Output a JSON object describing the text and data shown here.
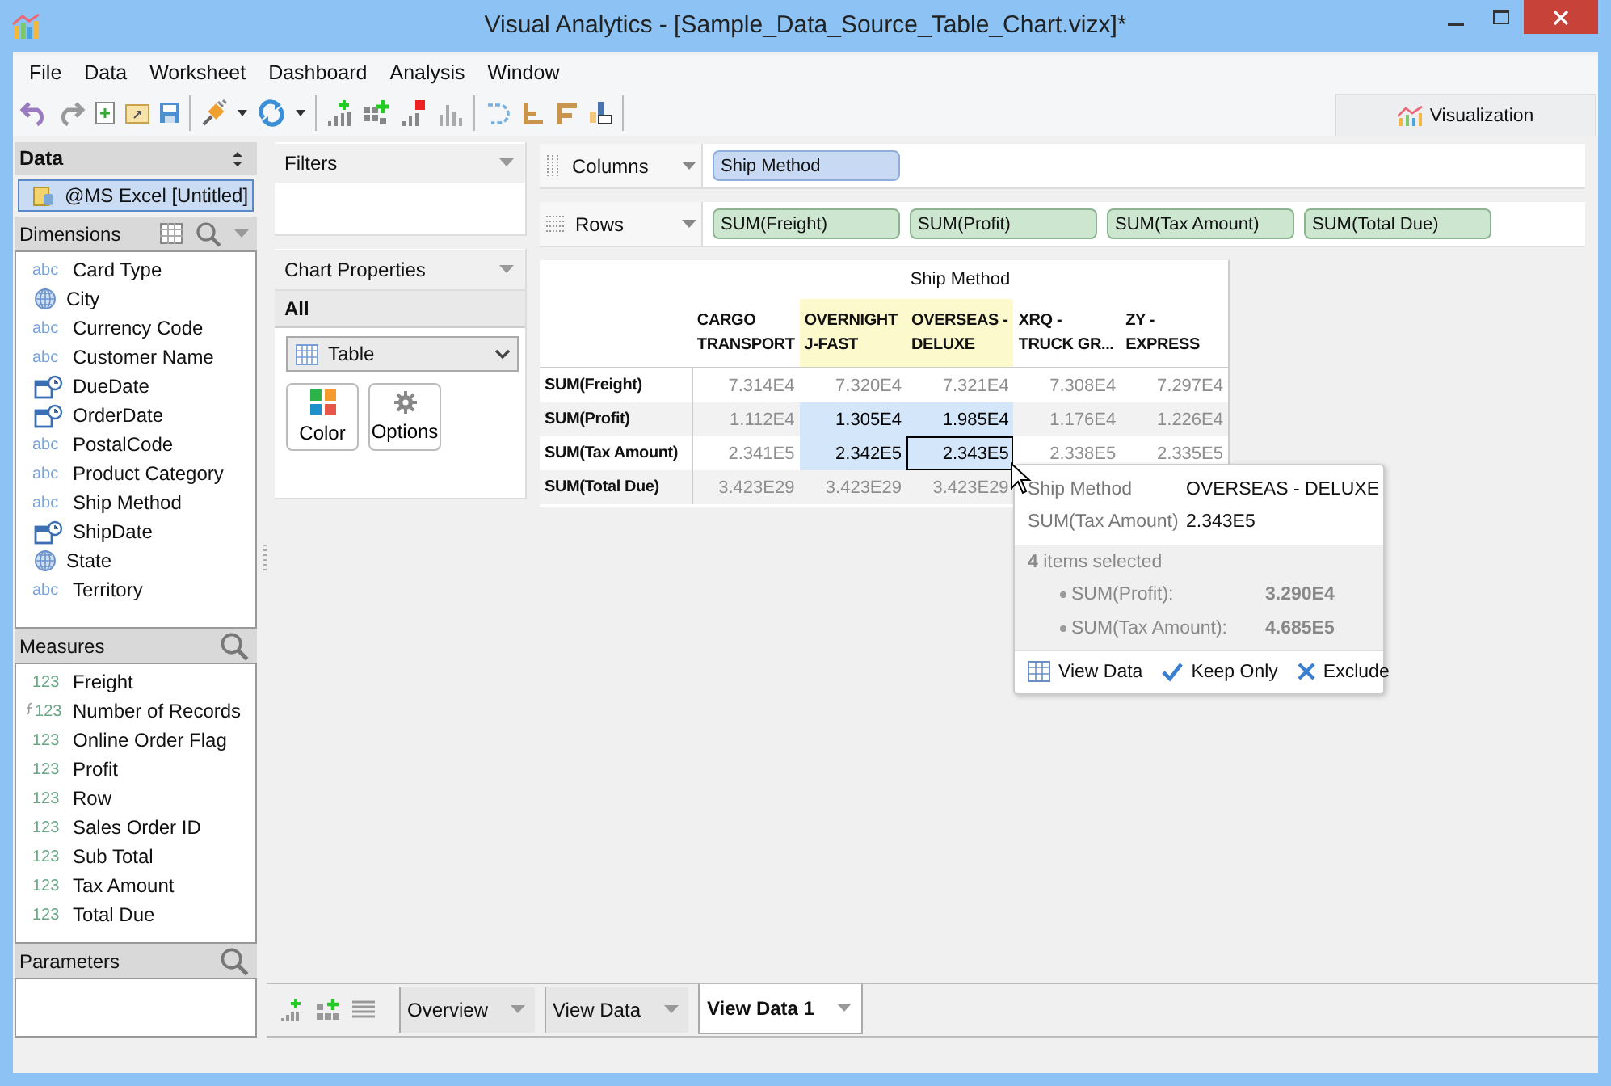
{
  "window": {
    "title": "Visual Analytics - [Sample_Data_Source_Table_Chart.vizx]*"
  },
  "menu": [
    "File",
    "Data",
    "Worksheet",
    "Dashboard",
    "Analysis",
    "Window"
  ],
  "view_tab": {
    "label": "Visualization"
  },
  "data_panel": {
    "title": "Data",
    "source": {
      "label": "@MS Excel [Untitled]",
      "selected": true
    }
  },
  "dimensions": {
    "title": "Dimensions",
    "items": [
      {
        "label": "Card Type",
        "kind": "text",
        "badge": "abc"
      },
      {
        "label": "City",
        "kind": "geo"
      },
      {
        "label": "Currency Code",
        "kind": "text",
        "badge": "abc"
      },
      {
        "label": "Customer Name",
        "kind": "text",
        "badge": "abc"
      },
      {
        "label": "DueDate",
        "kind": "date"
      },
      {
        "label": "OrderDate",
        "kind": "date"
      },
      {
        "label": "PostalCode",
        "kind": "text",
        "badge": "abc"
      },
      {
        "label": "Product Category",
        "kind": "text",
        "badge": "abc"
      },
      {
        "label": "Ship Method",
        "kind": "text",
        "badge": "abc"
      },
      {
        "label": "ShipDate",
        "kind": "date"
      },
      {
        "label": "State",
        "kind": "geo"
      },
      {
        "label": "Territory",
        "kind": "text",
        "badge": "abc"
      }
    ]
  },
  "measures": {
    "title": "Measures",
    "items": [
      {
        "label": "Freight",
        "kind": "number",
        "badge": "123"
      },
      {
        "label": "Number of Records",
        "kind": "calc",
        "badge": "123"
      },
      {
        "label": "Online Order Flag",
        "kind": "number",
        "badge": "123"
      },
      {
        "label": "Profit",
        "kind": "number",
        "badge": "123"
      },
      {
        "label": "Row",
        "kind": "number",
        "badge": "123"
      },
      {
        "label": "Sales Order ID",
        "kind": "number",
        "badge": "123"
      },
      {
        "label": "Sub Total",
        "kind": "number",
        "badge": "123"
      },
      {
        "label": "Tax Amount",
        "kind": "number",
        "badge": "123"
      },
      {
        "label": "Total Due",
        "kind": "number",
        "badge": "123"
      }
    ]
  },
  "parameters": {
    "title": "Parameters"
  },
  "filters": {
    "title": "Filters"
  },
  "chart_properties": {
    "title": "Chart Properties",
    "scope": "All",
    "chart_type": "Table",
    "buttons": [
      {
        "label": "Color",
        "kind": "color"
      },
      {
        "label": "Options",
        "kind": "options"
      }
    ]
  },
  "shelves": [
    {
      "label": "Columns",
      "kind": "columns",
      "pills": [
        {
          "label": "Ship Method",
          "kind": "dimension"
        }
      ]
    },
    {
      "label": "Rows",
      "kind": "rows",
      "pills": [
        {
          "label": "SUM(Freight)",
          "kind": "measure"
        },
        {
          "label": "SUM(Profit)",
          "kind": "measure"
        },
        {
          "label": "SUM(Tax Amount)",
          "kind": "measure"
        },
        {
          "label": "SUM(Total Due)",
          "kind": "measure"
        }
      ]
    }
  ],
  "table": {
    "header": "Ship Method",
    "columns": [
      {
        "label": "CARGO TRANSPORT",
        "highlighted": false
      },
      {
        "label": "OVERNIGHT J-FAST",
        "highlighted": true
      },
      {
        "label": "OVERSEAS - DELUXE",
        "highlighted": true
      },
      {
        "label": "XRQ - TRUCK GR...",
        "highlighted": false
      },
      {
        "label": "ZY - EXPRESS",
        "highlighted": false
      }
    ],
    "rows": [
      {
        "label": "SUM(Freight)",
        "cells": [
          {
            "value": "7.314E4",
            "selected": false
          },
          {
            "value": "7.320E4",
            "selected": false
          },
          {
            "value": "7.321E4",
            "selected": false
          },
          {
            "value": "7.308E4",
            "selected": false
          },
          {
            "value": "7.297E4",
            "selected": false
          }
        ]
      },
      {
        "label": "SUM(Profit)",
        "cells": [
          {
            "value": "1.112E4",
            "selected": false
          },
          {
            "value": "1.305E4",
            "selected": true
          },
          {
            "value": "1.985E4",
            "selected": true
          },
          {
            "value": "1.176E4",
            "selected": false
          },
          {
            "value": "1.226E4",
            "selected": false
          }
        ]
      },
      {
        "label": "SUM(Tax Amount)",
        "cells": [
          {
            "value": "2.341E5",
            "selected": false
          },
          {
            "value": "2.342E5",
            "selected": true
          },
          {
            "value": "2.343E5",
            "selected": true,
            "focused": true
          },
          {
            "value": "2.338E5",
            "selected": false
          },
          {
            "value": "2.335E5",
            "selected": false
          }
        ]
      },
      {
        "label": "SUM(Total Due)",
        "cells": [
          {
            "value": "3.423E29",
            "selected": false
          },
          {
            "value": "3.423E29",
            "selected": false
          },
          {
            "value": "3.423E29",
            "selected": false
          }
        ]
      }
    ]
  },
  "tooltip": {
    "fields": [
      {
        "label": "Ship Method",
        "value": "OVERSEAS - DELUXE"
      },
      {
        "label": "SUM(Tax Amount)",
        "value": "2.343E5"
      }
    ],
    "summary": "**4** items selected",
    "totals": [
      {
        "label": "SUM(Profit):",
        "value": "3.290E4"
      },
      {
        "label": "SUM(Tax Amount):",
        "value": "4.685E5"
      }
    ],
    "actions": [
      {
        "label": "View Data",
        "kind": "view"
      },
      {
        "label": "Keep Only",
        "kind": "keep"
      },
      {
        "label": "Exclude",
        "kind": "exclude"
      }
    ]
  },
  "sheet_tabs": [
    {
      "label": "Overview",
      "selected": false
    },
    {
      "label": "View Data",
      "selected": false
    },
    {
      "label": "View Data 1",
      "selected": true
    }
  ]
}
